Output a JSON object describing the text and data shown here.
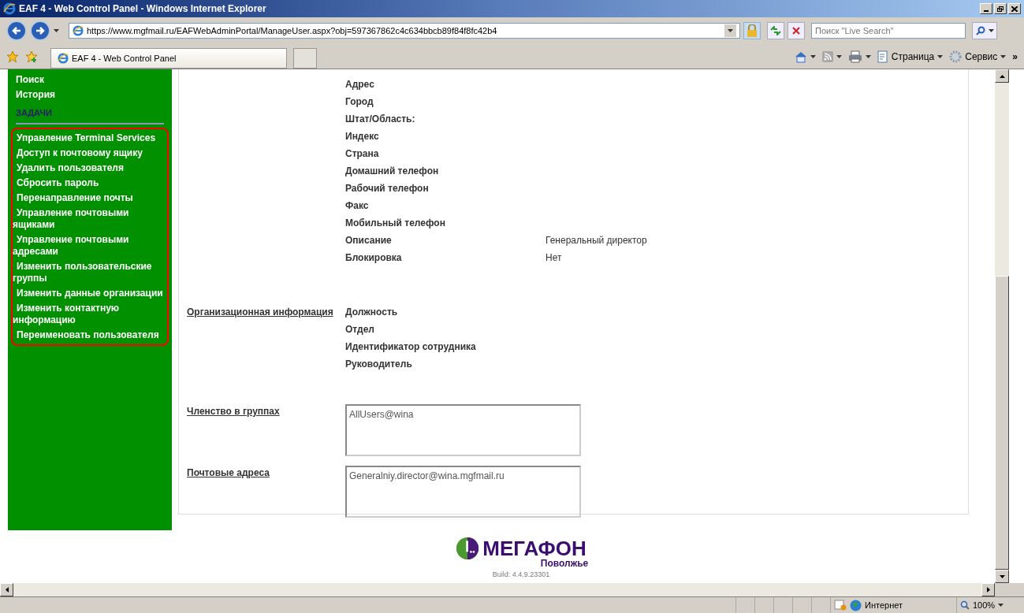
{
  "window": {
    "title": "EAF 4 - Web Control Panel - Windows Internet Explorer"
  },
  "address_bar": {
    "url": "https://www.mgfmail.ru/EAFWebAdminPortal/ManageUser.aspx?obj=597367862c4c634bbcb89f84f8fc42b4"
  },
  "search": {
    "placeholder": "Поиск \"Live Search\""
  },
  "tab": {
    "title": "EAF 4 - Web Control Panel"
  },
  "command_bar": [
    {
      "kind": "home"
    },
    {
      "kind": "feeds"
    },
    {
      "kind": "print"
    },
    {
      "kind": "page",
      "label": "Страница"
    },
    {
      "kind": "tools",
      "label": "Сервис"
    }
  ],
  "command_bar_more": "»",
  "sidebar": {
    "links": [
      "Поиск",
      "История"
    ],
    "heading": "ЗАДАЧИ",
    "tasks": [
      "Управление Terminal Services",
      "Доступ к почтовому ящику",
      "Удалить пользователя",
      "Сбросить пароль",
      "Перенаправление почты",
      "Управление почтовыми ящиками",
      "Управление почтовыми адресами",
      "Изменить пользовательские группы",
      "Изменить данные организации",
      "Изменить контактную информацию",
      "Переименовать пользователя"
    ]
  },
  "contact_fields": [
    {
      "label": "Адрес"
    },
    {
      "label": "Город"
    },
    {
      "label": "Штат/Область:"
    },
    {
      "label": "Индекс"
    },
    {
      "label": "Страна"
    },
    {
      "label": "Домашний телефон"
    },
    {
      "label": "Рабочий телефон"
    },
    {
      "label": "Факс"
    },
    {
      "label": "Мобильный телефон"
    },
    {
      "label": "Описание",
      "value": "Генеральный директор"
    },
    {
      "label": "Блокировка",
      "value": "Нет"
    }
  ],
  "organization": {
    "link": "Организационная информация",
    "fields": [
      "Должность",
      "Отдел",
      "Идентификатор сотрудника",
      "Руководитель"
    ]
  },
  "groups": {
    "link": "Членство в группах",
    "items": [
      "AllUsers@wina"
    ]
  },
  "emails": {
    "link": "Почтовые адреса",
    "items": [
      "Generalniy.director@wina.mgfmail.ru"
    ]
  },
  "footer": {
    "logo": "МЕГАФОН",
    "region": "Поволжье",
    "build": "Build: 4.4.9.23301"
  },
  "status_bar": {
    "zone": "Интернет",
    "zoom": "100%"
  }
}
